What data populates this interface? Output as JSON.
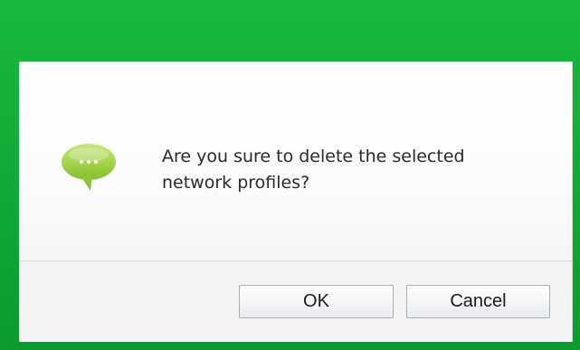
{
  "dialog": {
    "message": "Are you sure to delete the selected\nnetwork profiles?",
    "icon": "speech-bubble-ellipsis",
    "ok_label": "OK",
    "cancel_label": "Cancel"
  },
  "colors": {
    "background_green": "#12b038",
    "icon_green": "#9fd048",
    "dialog_bg": "#ffffff",
    "footer_bg": "#f2f3f5"
  }
}
